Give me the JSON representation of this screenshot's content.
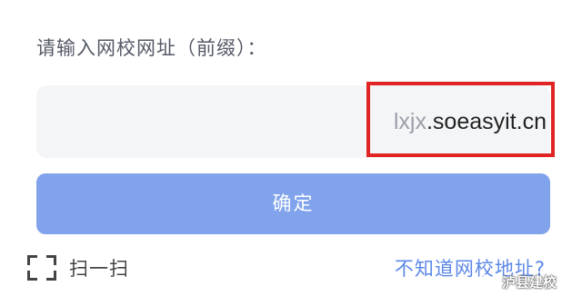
{
  "prompt": {
    "label": "请输入网校网址（前缀）："
  },
  "url_input": {
    "prefix_value": "lxjx",
    "domain_suffix": ".soeasyit.cn"
  },
  "highlight": {
    "color": "#e02424"
  },
  "confirm_button": {
    "label": "确定",
    "color": "#80a3eb"
  },
  "scan": {
    "icon": "scan-frame-icon",
    "label": "扫一扫"
  },
  "help_link": {
    "label": "不知道网校地址?",
    "color": "#5d88e8"
  },
  "watermark": {
    "icon": "wechat-icon",
    "text": "泸县建校"
  }
}
